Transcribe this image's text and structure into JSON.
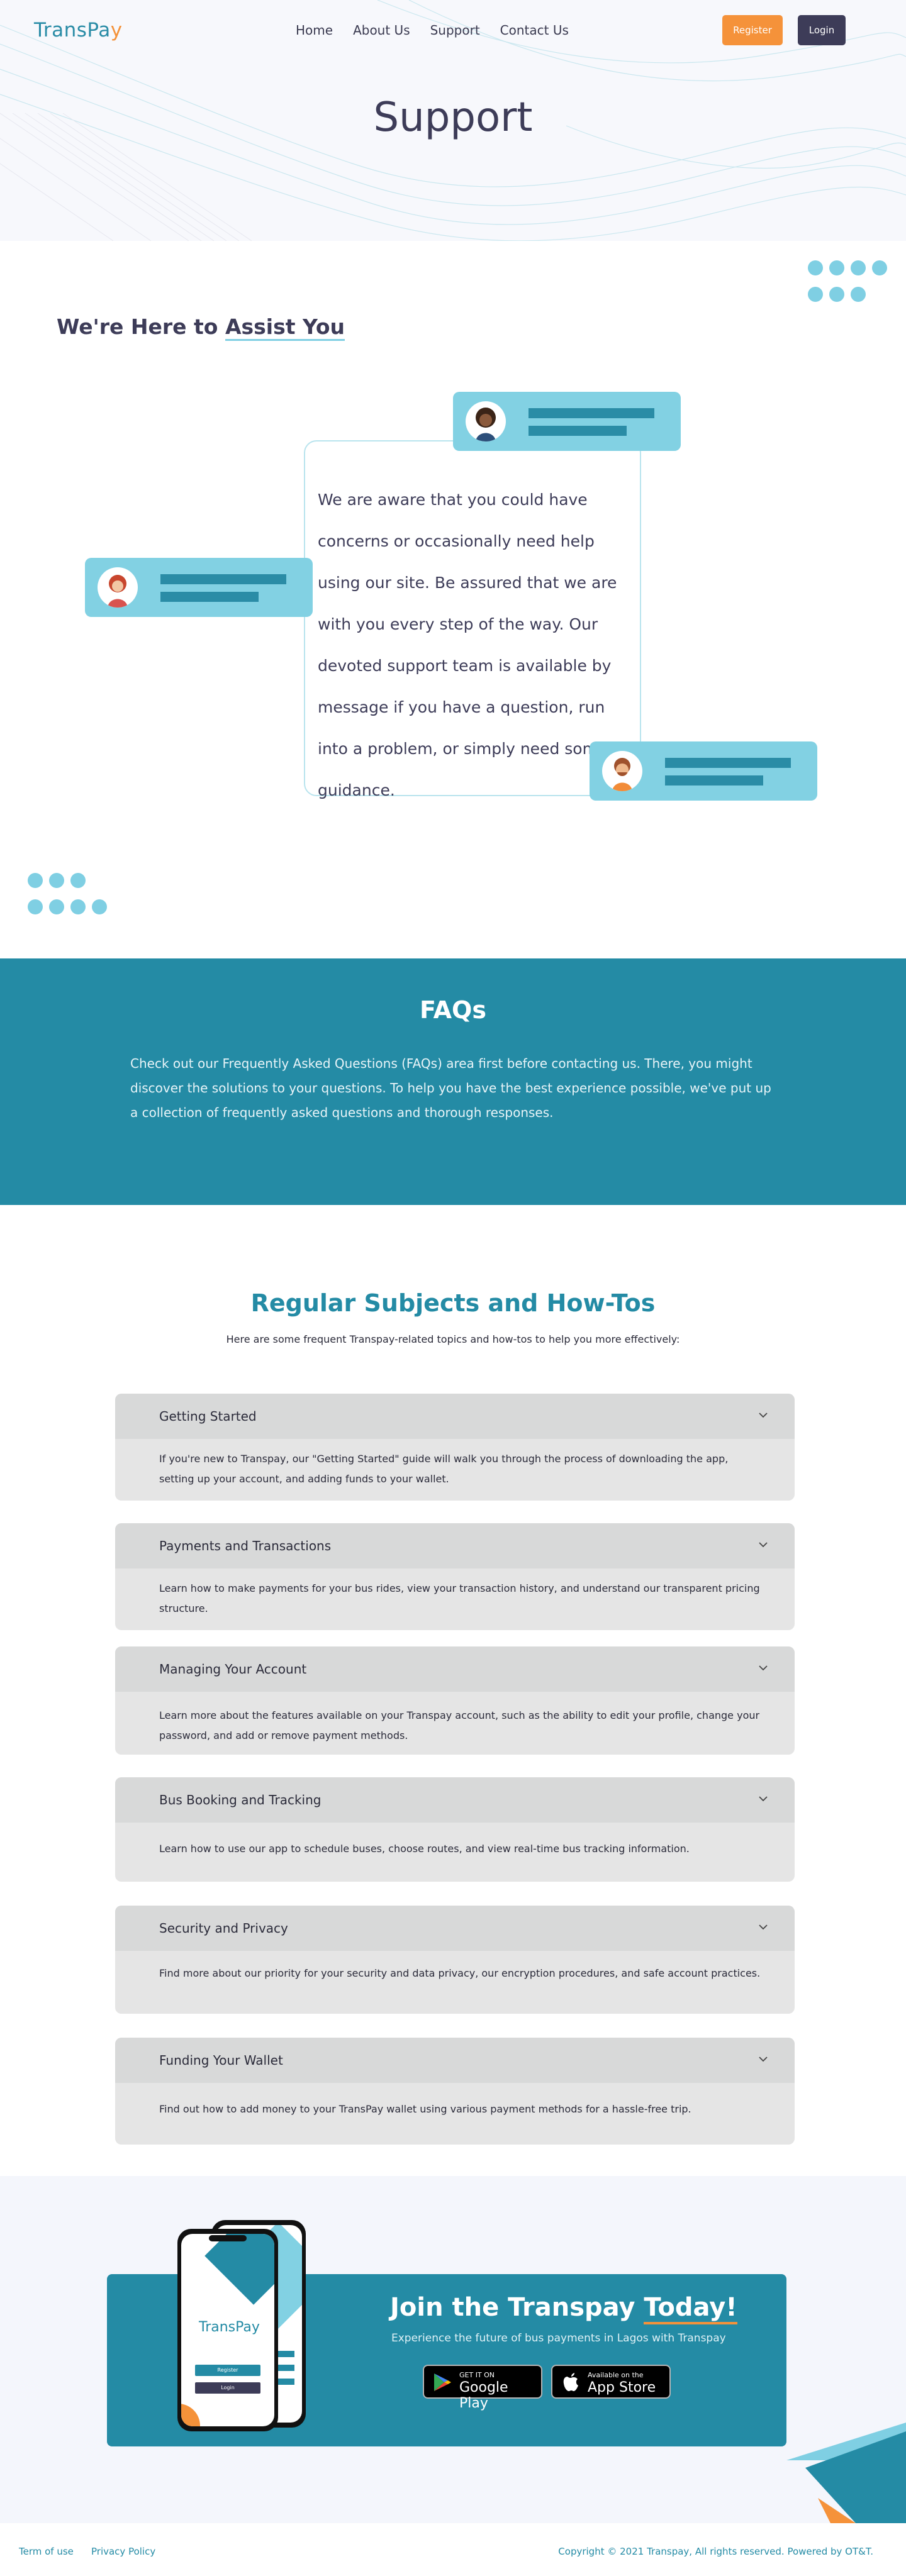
{
  "header": {
    "logo_main": "TransPa",
    "logo_accent": "y",
    "nav": [
      "Home",
      "About Us",
      "Support",
      "Contact Us"
    ],
    "register_label": "Register",
    "login_label": "Login"
  },
  "hero": {
    "title": "Support"
  },
  "assist": {
    "heading_prefix": "We're Here to ",
    "heading_underlined": "Assist You",
    "body": "We are aware that you could have concerns or occasionally need help using our site. Be assured that we are with you every step of the way. Our devoted support team is available by message if you have a question, run into a problem, or simply need some guidance."
  },
  "faq": {
    "title": "FAQs",
    "body": "Check out our Frequently Asked Questions (FAQs) area first before contacting us. There, you might discover the solutions to your questions. To help you have the best experience possible, we've put up a collection of frequently asked questions and thorough responses."
  },
  "subjects": {
    "title": "Regular Subjects and How-Tos",
    "subtitle": "Here are some frequent Transpay-related topics and how-tos to help you more effectively:",
    "items": [
      {
        "title": "Getting Started",
        "body": "If you're new to Transpay, our \"Getting Started\" guide will walk you through the process of downloading the app, setting up your account, and adding funds to your wallet."
      },
      {
        "title": "Payments and Transactions",
        "body": "Learn how to make payments for your bus rides, view your transaction history, and understand our transparent pricing structure."
      },
      {
        "title": "Managing Your Account",
        "body": "Learn more about the features available on your Transpay account, such as the ability to edit your profile, change your password, and add or remove payment methods."
      },
      {
        "title": "Bus Booking and Tracking",
        "body": "Learn how to use our app to schedule buses, choose routes, and view real-time bus tracking information."
      },
      {
        "title": "Security and Privacy",
        "body": "Find more about our priority for your security and data privacy, our encryption procedures, and safe account practices."
      },
      {
        "title": "Funding Your Wallet",
        "body": "Find out how to add money to your TransPay wallet using various payment methods for a hassle-free trip."
      }
    ]
  },
  "cta": {
    "title_prefix": "Join the Transpay ",
    "title_underlined": "Today!",
    "subtitle": "Experience the future of bus payments in Lagos with Transpay",
    "google_small": "GET IT ON",
    "google_big": "Google Play",
    "apple_small": "Available on the",
    "apple_big": "App Store",
    "phone_logo": "TransPay",
    "phone_register": "Register",
    "phone_login": "Login"
  },
  "footer": {
    "terms": "Term of use",
    "privacy": "Privacy Policy",
    "copyright": "Copyright © 2021 Transpay, All rights reserved. Powered by  OT&T."
  },
  "colors": {
    "brand": "#248ba5",
    "accent": "#f5923a",
    "dark": "#3d3c58",
    "light_blue": "#82d1e3"
  }
}
